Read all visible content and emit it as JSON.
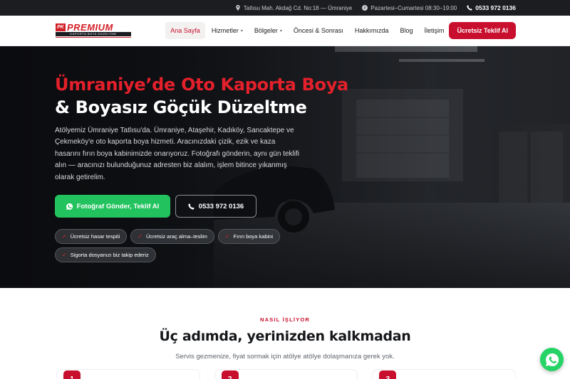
{
  "topbar": {
    "address": "Tatlısu Mah. Akdağ Cd. No:18 — Ümraniye",
    "hours": "Pazartesi–Cumartesi 08:30–19:00",
    "phone": "0533 972 0136"
  },
  "logo": {
    "badge": "PK",
    "word": "PREMIUM",
    "tagline": "KAPORTA BOYA DÜZELTME"
  },
  "nav": {
    "items": [
      {
        "label": "Ana Sayfa",
        "active": true
      },
      {
        "label": "Hizmetler",
        "dropdown": true
      },
      {
        "label": "Bölgeler",
        "dropdown": true
      },
      {
        "label": "Öncesi & Sonrası"
      },
      {
        "label": "Hakkımızda"
      },
      {
        "label": "Blog"
      },
      {
        "label": "İletişim"
      }
    ],
    "cta": "Ücretsiz Teklif Al"
  },
  "hero": {
    "title_line1": "Ümraniye’de Oto Kaporta Boya",
    "title_line2": "& Boyasız Göçük Düzeltme",
    "description": "Atölyemiz Ümraniye Tatlısu'da. Ümraniye, Ataşehir, Kadıköy, Sancaktepe ve Çekmeköy'e oto kaporta boya hizmeti. Aracınızdaki çizik, ezik ve kaza hasarını fırın boya kabinimizde onarıyoruz. Fotoğrafı gönderin, aynı gün teklifi alın — aracınızı bulunduğunuz adresten biz alalım, işlem bitince yıkanmış olarak getirelim.",
    "primary_button": "Fotoğraf Gönder, Teklif Al",
    "phone_button": "0533 972 0136",
    "chips": [
      "Ücretsiz hasar tespiti",
      "Ücretsiz araç alma–teslim",
      "Fırın boya kabini",
      "Sigorta dosyanızı biz takip ederiz"
    ]
  },
  "how": {
    "eyebrow": "NASIL İŞLİYOR",
    "title": "Üç adımda, yerinizden kalkmadan",
    "subtitle": "Servis gezmenize, fiyat sormak için atölye atölye dolaşmanıza gerek yok.",
    "steps": [
      "1",
      "2",
      "3"
    ]
  },
  "colors": {
    "brand_red": "#c8102e",
    "hero_red": "#e3202b",
    "whatsapp_green": "#22c35e",
    "dark": "#1b1d21"
  },
  "icons": [
    "location-pin-icon",
    "clock-icon",
    "phone-icon",
    "whatsapp-icon",
    "chevron-down-icon"
  ]
}
